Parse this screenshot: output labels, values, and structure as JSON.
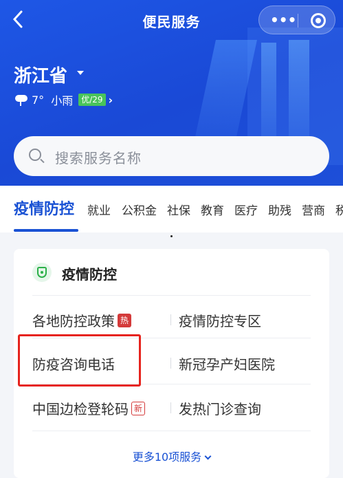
{
  "header": {
    "back_icon": "chevron-left-icon",
    "title": "便民服务",
    "more_icon": "ellipsis-icon",
    "more_glyph": "•••",
    "close_icon": "target-icon"
  },
  "location": {
    "province": "浙江省",
    "weather_icon": "cloud-rain-icon",
    "temperature": "7°",
    "condition": "小雨",
    "air_quality": "优/29",
    "arrow": "›"
  },
  "search": {
    "placeholder": "搜索服务名称"
  },
  "tabs": [
    {
      "label": "疫情防控",
      "active": true
    },
    {
      "label": "就业"
    },
    {
      "label": "公积金"
    },
    {
      "label": "社保"
    },
    {
      "label": "教育"
    },
    {
      "label": "医疗"
    },
    {
      "label": "助残"
    },
    {
      "label": "营商"
    },
    {
      "label": "税"
    }
  ],
  "card": {
    "title": "疫情防控",
    "icon": "shield-icon",
    "services": [
      {
        "label": "各地防控政策",
        "badge": "热"
      },
      {
        "label": "疫情防控专区"
      },
      {
        "label": "防疫咨询电话"
      },
      {
        "label": "新冠孕产妇医院"
      },
      {
        "label": "中国边检登轮码",
        "badge": "新"
      },
      {
        "label": "发热门诊查询"
      }
    ],
    "more_label": "更多10项服务"
  },
  "colors": {
    "primary": "#1a52d4",
    "header_bg": "#1e57e6",
    "badge_red": "#d43a3a",
    "highlight_red": "#e6231d",
    "aq_green": "#49c45b"
  }
}
